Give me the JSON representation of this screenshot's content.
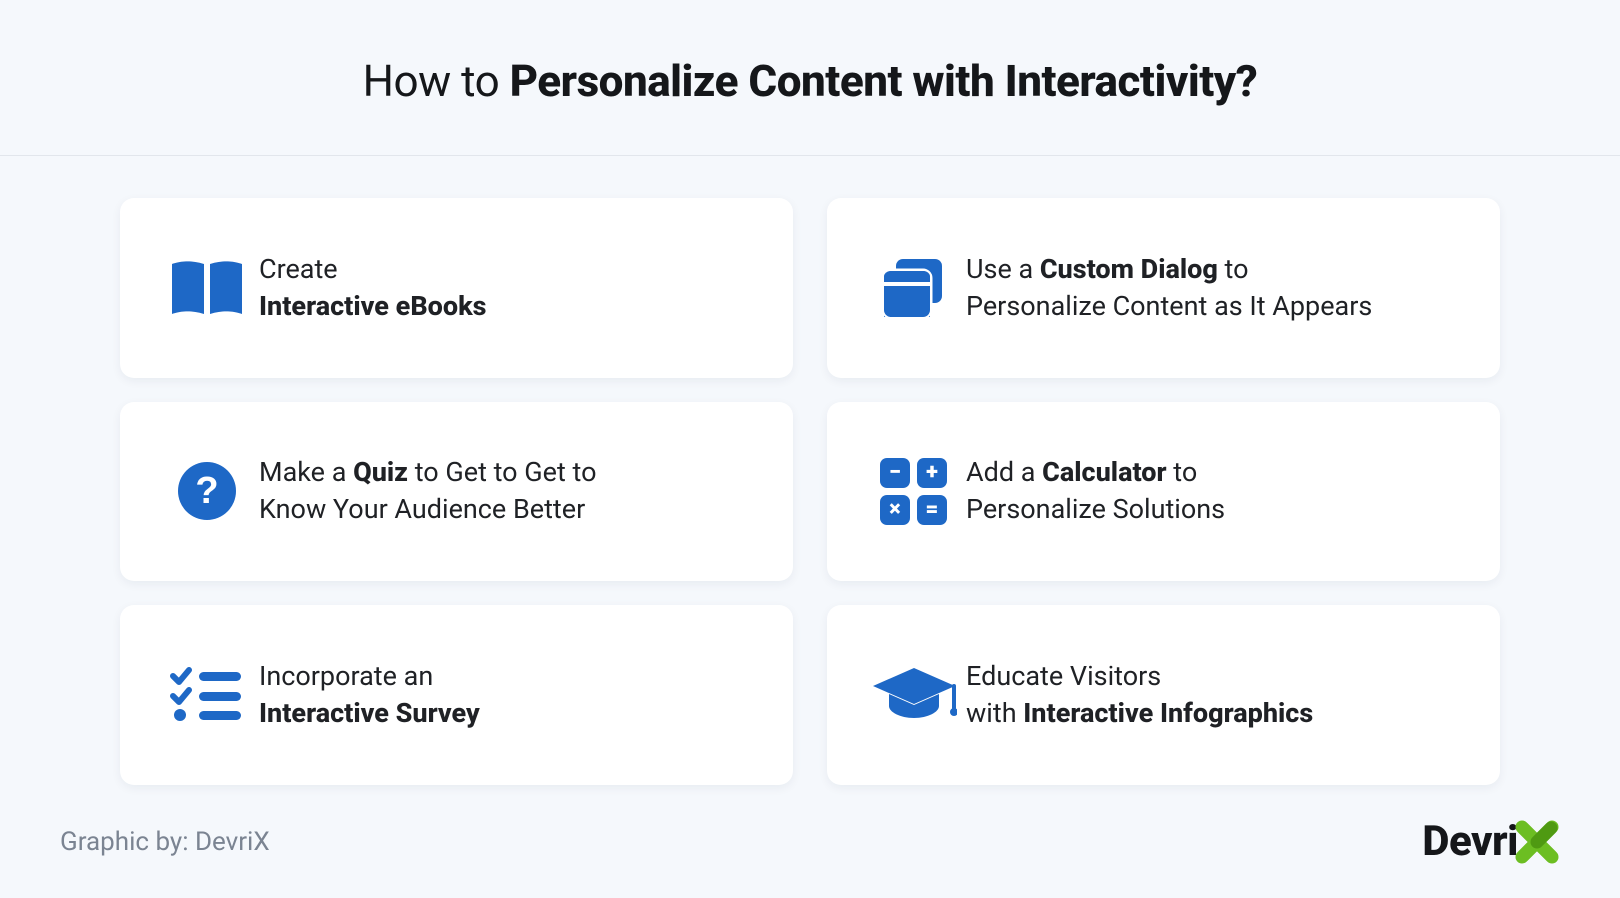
{
  "colors": {
    "accent": "#1e68c6",
    "brand_x": "#6cbe22",
    "text": "#1a1a1a",
    "muted": "#7b8492",
    "card_bg": "#ffffff",
    "page_bg": "#f5f8fc"
  },
  "header": {
    "title_prefix": "How to ",
    "title_bold": "Personalize Content with Interactivity?"
  },
  "cards": [
    {
      "icon": "book-open-icon",
      "line1_prefix": "Create",
      "line2_bold": "Interactive eBooks"
    },
    {
      "icon": "dialog-stack-icon",
      "line1_prefix": "Use a ",
      "line1_bold": "Custom Dialog",
      "line1_suffix": " to",
      "line2_plain": "Personalize Content as It Appears"
    },
    {
      "icon": "question-circle-icon",
      "line1_prefix": "Make a ",
      "line1_bold": "Quiz",
      "line1_suffix": " to Get to Get to",
      "line2_plain": "Know Your Audience Better"
    },
    {
      "icon": "calculator-icon",
      "calc_symbols": [
        "−",
        "+",
        "×",
        "="
      ],
      "line1_prefix": "Add a ",
      "line1_bold": "Calculator",
      "line1_suffix": " to",
      "line2_plain": "Personalize Solutions"
    },
    {
      "icon": "survey-list-icon",
      "line1_prefix": "Incorporate an",
      "line2_bold": "Interactive Survey"
    },
    {
      "icon": "graduation-cap-icon",
      "line1_prefix": "Educate Visitors",
      "line2_prefix": "with ",
      "line2_bold": "Interactive Infographics"
    }
  ],
  "footer": {
    "credit": "Graphic by: DevriX",
    "brand_text": "Devri"
  }
}
